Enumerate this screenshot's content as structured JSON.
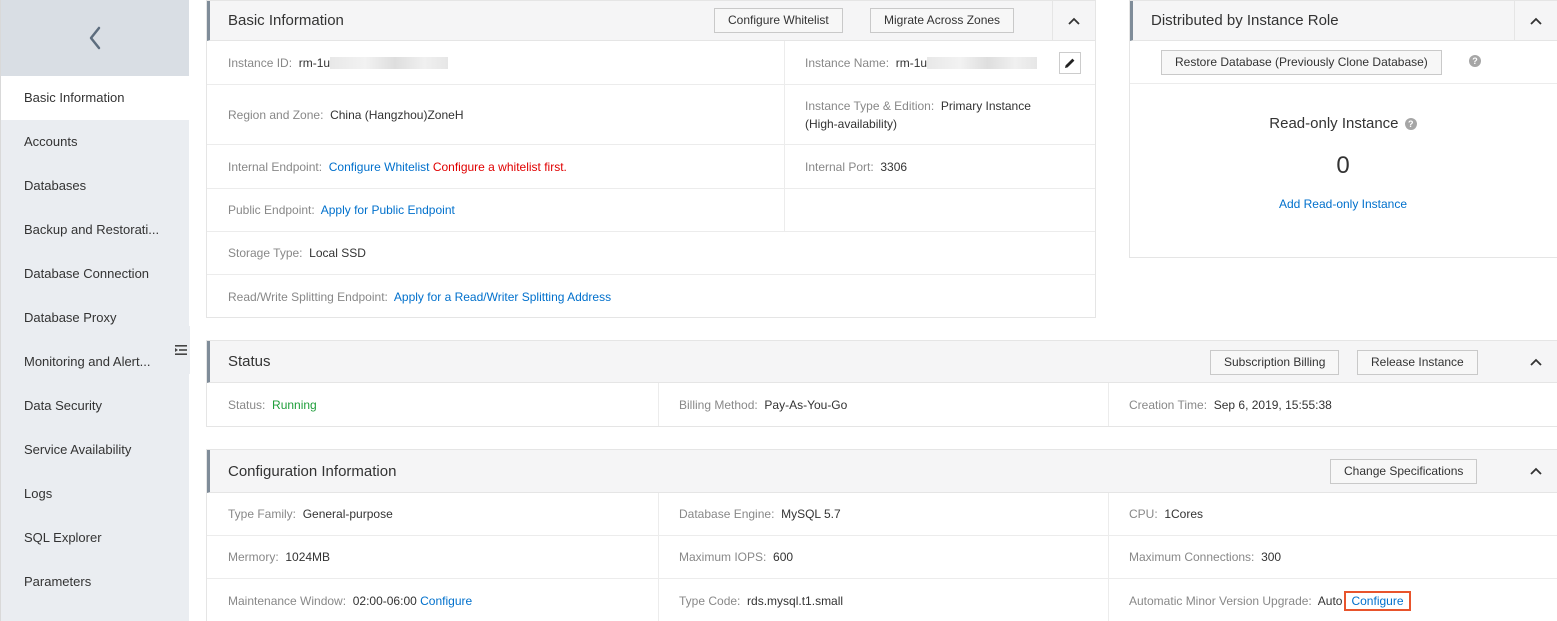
{
  "sidebar": {
    "items": [
      {
        "label": "Basic Information",
        "active": true
      },
      {
        "label": "Accounts"
      },
      {
        "label": "Databases"
      },
      {
        "label": "Backup and Restorati..."
      },
      {
        "label": "Database Connection"
      },
      {
        "label": "Database Proxy"
      },
      {
        "label": "Monitoring and Alert..."
      },
      {
        "label": "Data Security"
      },
      {
        "label": "Service Availability"
      },
      {
        "label": "Logs"
      },
      {
        "label": "SQL Explorer"
      },
      {
        "label": "Parameters"
      }
    ]
  },
  "basic": {
    "title": "Basic Information",
    "btn_whitelist": "Configure Whitelist",
    "btn_migrate": "Migrate Across Zones",
    "instance_id_label": "Instance ID:",
    "instance_id_value": "rm-1u",
    "instance_name_label": "Instance Name:",
    "instance_name_value": "rm-1u",
    "region_label": "Region and Zone:",
    "region_value": "China (Hangzhou)ZoneH",
    "type_label": "Instance Type & Edition:",
    "type_value_1": "Primary Instance",
    "type_value_2": "(High-availability)",
    "internal_endpoint_label": "Internal Endpoint:",
    "internal_endpoint_link": "Configure Whitelist",
    "internal_endpoint_warn": "Configure a whitelist first.",
    "internal_port_label": "Internal Port:",
    "internal_port_value": "3306",
    "public_endpoint_label": "Public Endpoint:",
    "public_endpoint_link": "Apply for Public Endpoint",
    "storage_label": "Storage Type:",
    "storage_value": "Local SSD",
    "rw_label": "Read/Write Splitting Endpoint:",
    "rw_link": "Apply for a Read/Writer Splitting Address"
  },
  "role": {
    "title": "Distributed by Instance Role",
    "restore_btn": "Restore Database (Previously Clone Database)",
    "readonly_label": "Read-only Instance",
    "readonly_count": "0",
    "add_link": "Add Read-only Instance"
  },
  "status": {
    "title": "Status",
    "btn_subscription": "Subscription Billing",
    "btn_release": "Release Instance",
    "status_label": "Status:",
    "status_value": "Running",
    "billing_label": "Billing Method:",
    "billing_value": "Pay-As-You-Go",
    "creation_label": "Creation Time:",
    "creation_value": "Sep 6, 2019, 15:55:38"
  },
  "config": {
    "title": "Configuration Information",
    "btn_change": "Change Specifications",
    "type_family_label": "Type Family:",
    "type_family_value": "General-purpose",
    "engine_label": "Database Engine:",
    "engine_value": "MySQL 5.7",
    "cpu_label": "CPU:",
    "cpu_value": "1Cores",
    "memory_label": "Mermory:",
    "memory_value": "1024MB",
    "iops_label": "Maximum IOPS:",
    "iops_value": "600",
    "connections_label": "Maximum Connections:",
    "connections_value": "300",
    "maintenance_label": "Maintenance Window:",
    "maintenance_value": "02:00-06:00",
    "maintenance_link": "Configure",
    "type_code_label": "Type Code:",
    "type_code_value": "rds.mysql.t1.small",
    "auto_upgrade_label": "Automatic Minor Version Upgrade:",
    "auto_upgrade_value": "Auto",
    "auto_upgrade_link": "Configure"
  }
}
